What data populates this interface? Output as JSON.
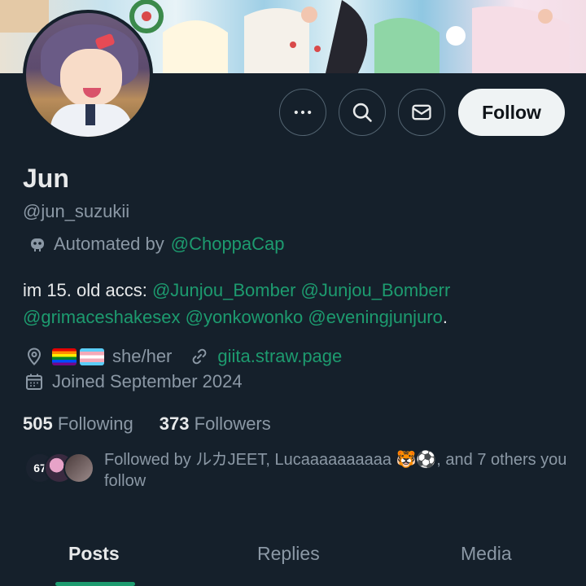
{
  "profile": {
    "name": "Jun",
    "handle": "@jun_suzukii",
    "automated_prefix": "Automated by",
    "automated_account": "@ChoppaCap",
    "bio_text": "im 15. old accs:",
    "bio_links": [
      "@Junjou_Bomber",
      "@Junjou_Bomberr",
      "@grimaceshakesex",
      "@yonkowonko",
      "@eveningjunjuro"
    ],
    "bio_end": ".",
    "pronouns": "she/her",
    "website": "giita.straw.page",
    "joined": "Joined September 2024"
  },
  "stats": {
    "following_count": "505",
    "following_label": "Following",
    "followers_count": "373",
    "followers_label": "Followers"
  },
  "followed_by": {
    "text": "Followed by ルカJEET, Lucaaaaaaaaaa 🐯⚽, and 7 others you follow",
    "avatar_badge": "67"
  },
  "actions": {
    "follow_label": "Follow",
    "more_icon": "more-icon",
    "search_icon": "search-icon",
    "message_icon": "mail-icon"
  },
  "tabs": [
    {
      "label": "Posts"
    },
    {
      "label": "Replies"
    },
    {
      "label": "Media"
    }
  ],
  "colors": {
    "background": "#15202b",
    "accent": "#1d9b6f",
    "muted_text": "#8b98a5",
    "follow_button_bg": "#eff3f4"
  }
}
